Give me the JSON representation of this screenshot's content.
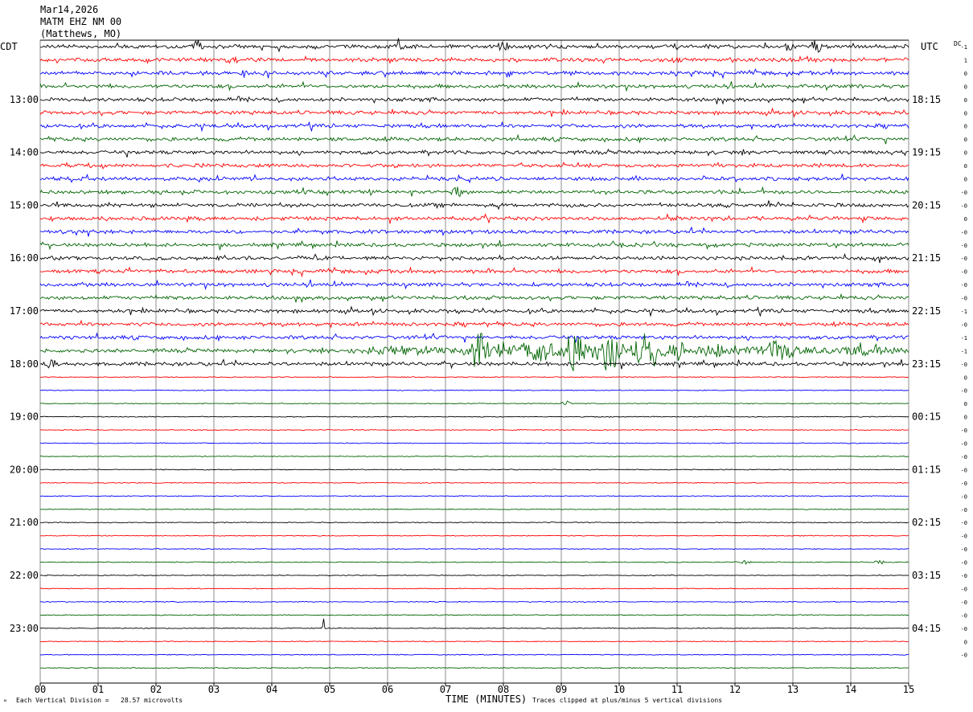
{
  "header": {
    "date": "Mar14,2026",
    "station": "MATM EHZ NM 00",
    "location": "(Matthews, MO)"
  },
  "left_axis_label": "CDT",
  "right_axis_label": "UTC",
  "dc_label": "DC",
  "footer": {
    "scale": "Each Vertical Division =   28.57 microvolts",
    "xlabel": "TIME (MINUTES)",
    "clip_note": "Traces clipped at plus/minus 5 vertical divisions"
  },
  "colors": {
    "black": "#000000",
    "red": "#ff0000",
    "blue": "#0000ff",
    "green": "#006400"
  },
  "chart_data": {
    "type": "line",
    "title": "MATM EHZ NM 00",
    "xlabel": "TIME (MINUTES)",
    "xlim": [
      0,
      15
    ],
    "x_ticks": [
      "00",
      "01",
      "02",
      "03",
      "04",
      "05",
      "06",
      "07",
      "08",
      "09",
      "10",
      "11",
      "12",
      "13",
      "14",
      "15"
    ],
    "trace_colors": [
      "black",
      "red",
      "blue",
      "green"
    ],
    "left_time_labels": [
      "13:00",
      "14:00",
      "15:00",
      "16:00",
      "17:00",
      "18:00",
      "19:00",
      "20:00",
      "21:00",
      "22:00",
      "23:00"
    ],
    "right_time_labels": [
      "18:15",
      "19:15",
      "20:15",
      "21:15",
      "22:15",
      "23:15",
      "00:15",
      "01:15",
      "02:15",
      "03:15",
      "04:15"
    ],
    "first_trace_label_index": 4,
    "dc_offsets": [
      "-1",
      "1",
      "0",
      "0",
      "0",
      "0",
      "0",
      "0",
      "0",
      "0",
      "0",
      "-0",
      "-0",
      "0",
      "-0",
      "-0",
      "-0",
      "-0",
      "-0",
      "-0",
      "-1",
      "-0",
      "-1",
      "-1",
      "-0",
      "0",
      "-0",
      "0",
      "0",
      "-0",
      "-0",
      "-0",
      "-0",
      "-0",
      "-0",
      "-0",
      "-0",
      "-0",
      "-0",
      "-0",
      "-0",
      "-0",
      "-0",
      "-0",
      "-0",
      "0",
      "-0"
    ],
    "traces": [
      {
        "index": 0,
        "amplitude": "high",
        "events": [
          {
            "minute": 2.7,
            "size": "large"
          },
          {
            "minute": 6.2,
            "size": "medium"
          },
          {
            "minute": 8.0,
            "size": "medium"
          },
          {
            "minute": 12.9,
            "size": "medium"
          },
          {
            "minute": 13.4,
            "size": "large"
          }
        ]
      },
      {
        "index": 1,
        "amplitude": "high",
        "events": [
          {
            "minute": 3.3,
            "size": "medium"
          },
          {
            "minute": 11.0,
            "size": "small"
          }
        ]
      },
      {
        "index": 2,
        "amplitude": "high",
        "events": [
          {
            "minute": 3.5,
            "size": "medium"
          },
          {
            "minute": 8.1,
            "size": "small"
          }
        ]
      },
      {
        "index": 3,
        "amplitude": "high"
      },
      {
        "index": 4,
        "amplitude": "high"
      },
      {
        "index": 5,
        "amplitude": "high"
      },
      {
        "index": 6,
        "amplitude": "high"
      },
      {
        "index": 7,
        "amplitude": "high"
      },
      {
        "index": 8,
        "amplitude": "high"
      },
      {
        "index": 9,
        "amplitude": "high"
      },
      {
        "index": 10,
        "amplitude": "high"
      },
      {
        "index": 11,
        "amplitude": "high",
        "events": [
          {
            "minute": 7.2,
            "size": "medium"
          }
        ]
      },
      {
        "index": 12,
        "amplitude": "high"
      },
      {
        "index": 13,
        "amplitude": "high"
      },
      {
        "index": 14,
        "amplitude": "high"
      },
      {
        "index": 15,
        "amplitude": "high"
      },
      {
        "index": 16,
        "amplitude": "high"
      },
      {
        "index": 17,
        "amplitude": "high"
      },
      {
        "index": 18,
        "amplitude": "high"
      },
      {
        "index": 19,
        "amplitude": "high"
      },
      {
        "index": 20,
        "amplitude": "high"
      },
      {
        "index": 21,
        "amplitude": "high"
      },
      {
        "index": 22,
        "amplitude": "high"
      },
      {
        "index": 23,
        "amplitude": "high",
        "bursts": [
          {
            "start": 5.2,
            "end": 7.3,
            "size": 0.5
          },
          {
            "start": 7.3,
            "end": 7.8,
            "size": 3.2
          },
          {
            "start": 7.8,
            "end": 8.3,
            "size": 1.5
          },
          {
            "start": 8.3,
            "end": 8.9,
            "size": 2.5
          },
          {
            "start": 8.9,
            "end": 9.6,
            "size": 3.0
          },
          {
            "start": 9.6,
            "end": 10.1,
            "size": 3.6
          },
          {
            "start": 10.2,
            "end": 10.8,
            "size": 3.6
          },
          {
            "start": 10.8,
            "end": 11.2,
            "size": 1.8
          },
          {
            "start": 11.2,
            "end": 12.3,
            "size": 1.2
          },
          {
            "start": 12.3,
            "end": 13.2,
            "size": 1.6
          },
          {
            "start": 13.2,
            "end": 15.0,
            "size": 0.6
          }
        ]
      },
      {
        "index": 24,
        "amplitude": "high",
        "events": [
          {
            "minute": 0.2,
            "size": "medium"
          }
        ]
      },
      {
        "index": 25,
        "amplitude": "low"
      },
      {
        "index": 26,
        "amplitude": "low"
      },
      {
        "index": 27,
        "amplitude": "low",
        "events": [
          {
            "minute": 9.1,
            "size": "small"
          }
        ]
      },
      {
        "index": 28,
        "amplitude": "low"
      },
      {
        "index": 29,
        "amplitude": "low"
      },
      {
        "index": 30,
        "amplitude": "low"
      },
      {
        "index": 31,
        "amplitude": "low"
      },
      {
        "index": 32,
        "amplitude": "low"
      },
      {
        "index": 33,
        "amplitude": "low"
      },
      {
        "index": 34,
        "amplitude": "low"
      },
      {
        "index": 35,
        "amplitude": "low"
      },
      {
        "index": 36,
        "amplitude": "low"
      },
      {
        "index": 37,
        "amplitude": "low"
      },
      {
        "index": 38,
        "amplitude": "low"
      },
      {
        "index": 39,
        "amplitude": "low",
        "events": [
          {
            "minute": 12.2,
            "size": "small"
          },
          {
            "minute": 14.5,
            "size": "small"
          }
        ]
      },
      {
        "index": 40,
        "amplitude": "low"
      },
      {
        "index": 41,
        "amplitude": "low"
      },
      {
        "index": 42,
        "amplitude": "low"
      },
      {
        "index": 43,
        "amplitude": "low"
      },
      {
        "index": 44,
        "amplitude": "low",
        "events": [
          {
            "minute": 4.9,
            "size": "spike"
          }
        ]
      },
      {
        "index": 45,
        "amplitude": "low"
      },
      {
        "index": 46,
        "amplitude": "low"
      },
      {
        "index": 47,
        "amplitude": "low"
      }
    ]
  }
}
